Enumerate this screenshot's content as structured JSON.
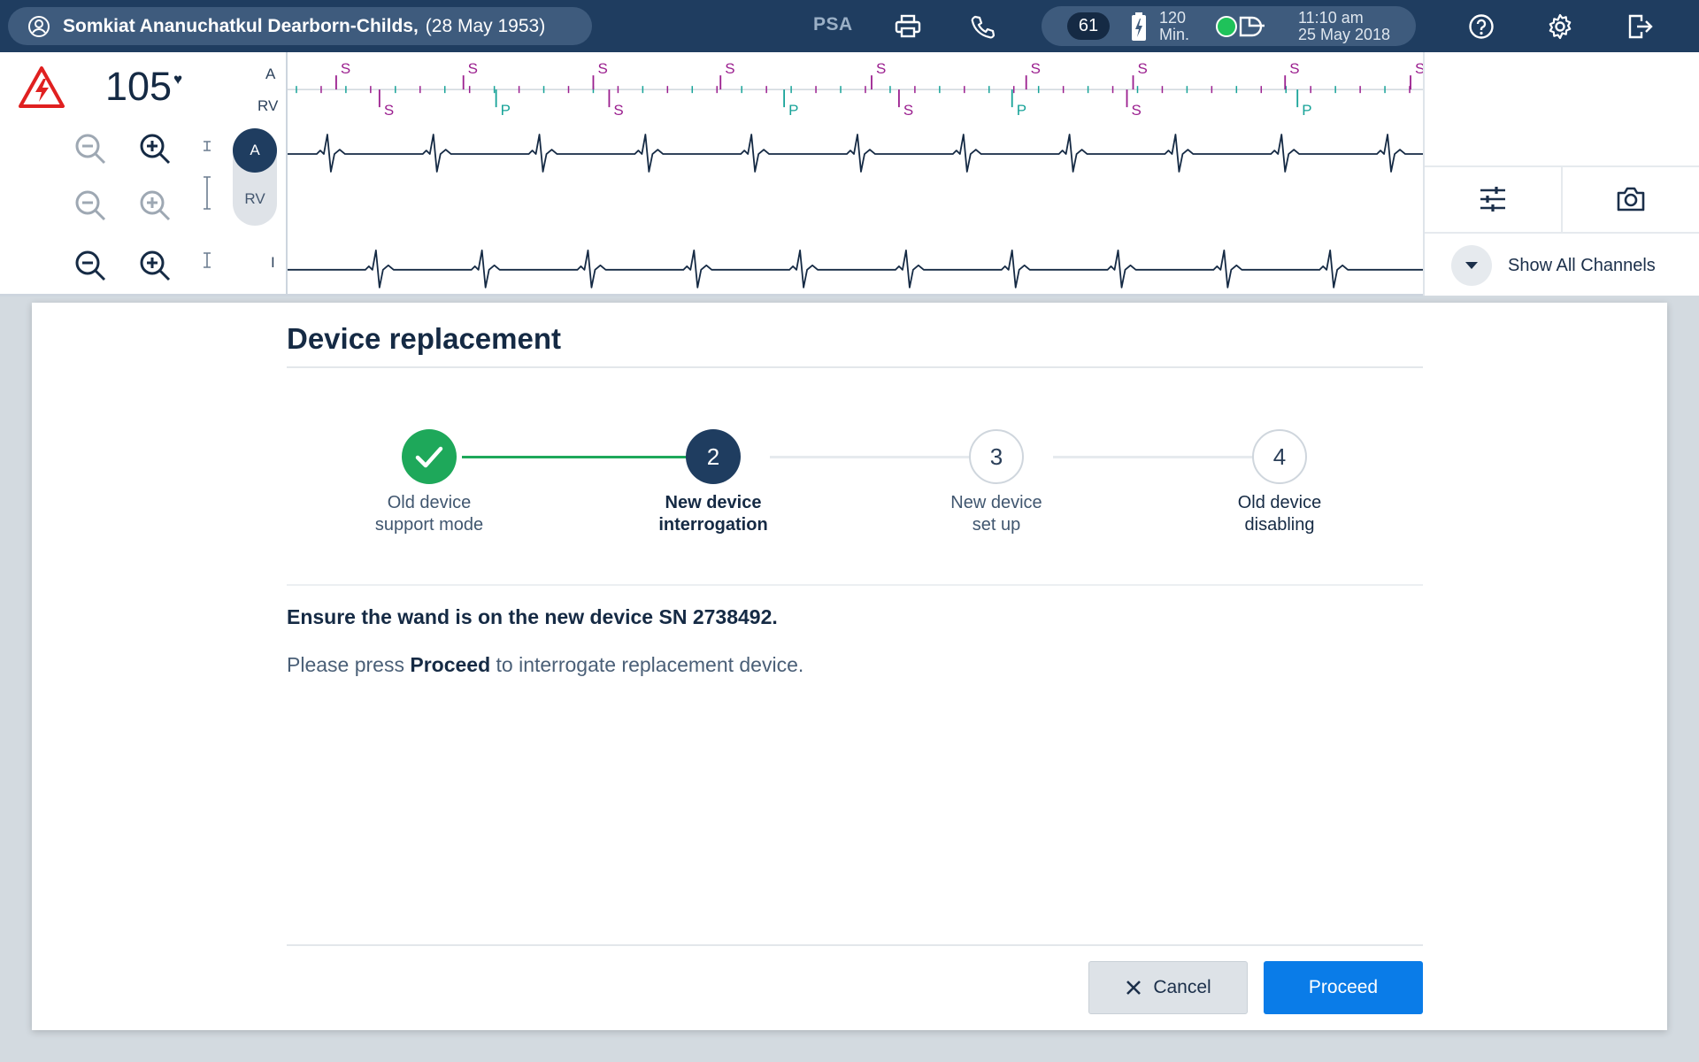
{
  "header": {
    "patient_name": "Somkiat Ananuchatkul Dearborn-Childs,",
    "patient_dob": "(28 May 1953)",
    "mode_label": "PSA",
    "heart_rate_badge": "61",
    "battery_minutes_value": "120",
    "battery_minutes_unit": "Min.",
    "time": "11:10 am",
    "date": "25 May 2018",
    "icons": [
      "user-icon",
      "print-icon",
      "phone-icon",
      "battery-icon",
      "connection-icon",
      "help-icon",
      "gear-icon",
      "exit-icon"
    ]
  },
  "ecg": {
    "heart_rate": "105",
    "heart_symbol": "♥",
    "channel_labels": [
      "A",
      "RV",
      "I"
    ],
    "toggle_a": "A",
    "toggle_rv": "RV",
    "markers": [
      "S",
      "P"
    ],
    "colors": {
      "sense": "#9b1f8f",
      "pace": "#17a398",
      "trace": "#152a44"
    }
  },
  "tools": {
    "show_all_label": "Show All Channels"
  },
  "dialog": {
    "title": "Device replacement",
    "steps": [
      {
        "line1": "Old device",
        "line2": "support mode",
        "number": "",
        "state": "done"
      },
      {
        "line1": "New device",
        "line2": "interrogation",
        "number": "2",
        "state": "active"
      },
      {
        "line1": "New device",
        "line2": "set up",
        "number": "3",
        "state": "todo"
      },
      {
        "line1": "Old device",
        "line2": "disabling",
        "number": "4",
        "state": "todo"
      }
    ],
    "message": "Ensure the wand is on the new device SN 2738492.",
    "instruction_prefix": "Please press",
    "instruction_bold": "Proceed",
    "instruction_suffix": "to interrogate replacement device.",
    "cancel_label": "Cancel",
    "proceed_label": "Proceed",
    "colors": {
      "done": "#1ea85a",
      "active": "#1f3d60",
      "primary": "#0a7ce8"
    }
  }
}
